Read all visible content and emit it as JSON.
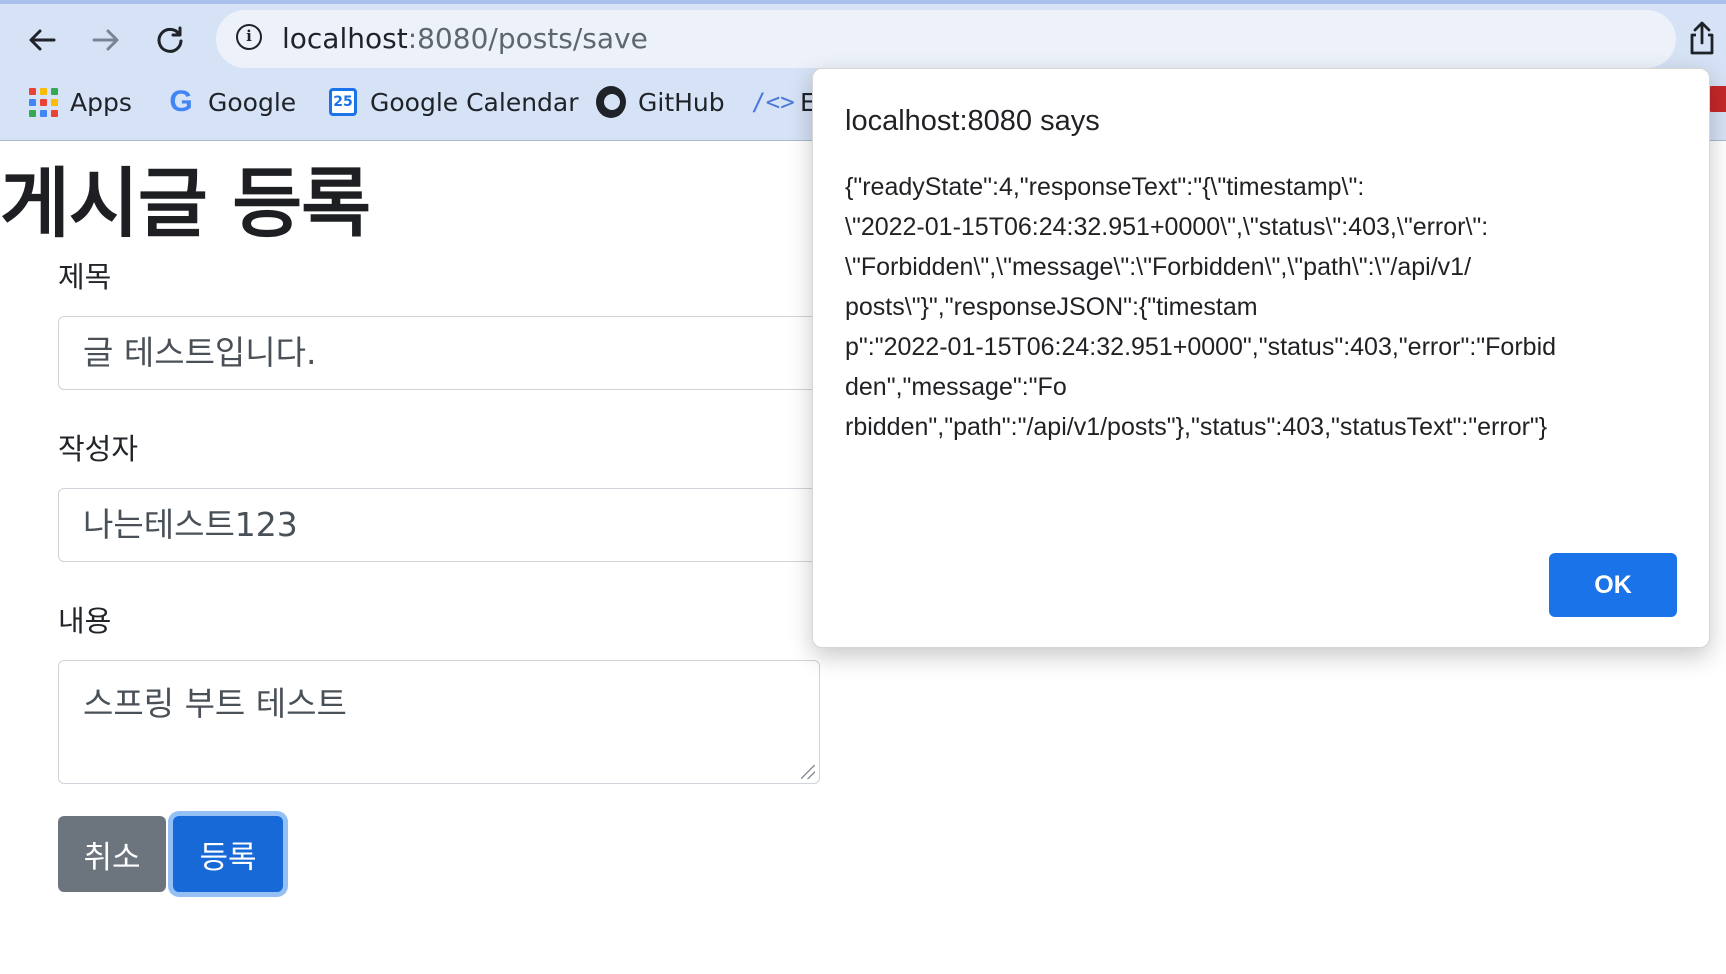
{
  "browser": {
    "url_host": "localhost",
    "url_path": ":8080/posts/save",
    "bookmarks": [
      {
        "label": "Apps",
        "icon": "apps-grid-icon"
      },
      {
        "label": "Google",
        "icon": "google-icon"
      },
      {
        "label": "Google Calendar",
        "icon": "calendar-icon",
        "icon_text": "25"
      },
      {
        "label": "GitHub",
        "icon": "github-icon"
      },
      {
        "label": "E",
        "icon": "code-icon"
      }
    ]
  },
  "page": {
    "title": "게시글 등록",
    "title_field": {
      "label": "제목",
      "value": "글 테스트입니다."
    },
    "author_field": {
      "label": "작성자",
      "value": "나는테스트123"
    },
    "content_field": {
      "label": "내용",
      "value": "스프링 부트 테스트"
    },
    "cancel_label": "취소",
    "save_label": "등록"
  },
  "dialog": {
    "title": "localhost:8080 says",
    "message_lines": [
      "{\"readyState\":4,\"responseText\":\"{\\\"timestamp\\\":",
      "\\\"2022-01-15T06:24:32.951+0000\\\",\\\"status\\\":403,\\\"error\\\":",
      "\\\"Forbidden\\\",\\\"message\\\":\\\"Forbidden\\\",\\\"path\\\":\\\"/api/v1/",
      "posts\\\"}\",\"responseJSON\":{\"timestam",
      "p\":\"2022-01-15T06:24:32.951+0000\",\"status\":403,\"error\":\"Forbid",
      "den\",\"message\":\"Fo",
      "rbidden\",\"path\":\"/api/v1/posts\"},\"status\":403,\"statusText\":\"error\"}"
    ],
    "ok_label": "OK"
  },
  "colors": {
    "chrome_bg": "#d6e2f5",
    "primary": "#1669d6",
    "secondary": "#6c757d",
    "dialog_button": "#1a73e8"
  }
}
